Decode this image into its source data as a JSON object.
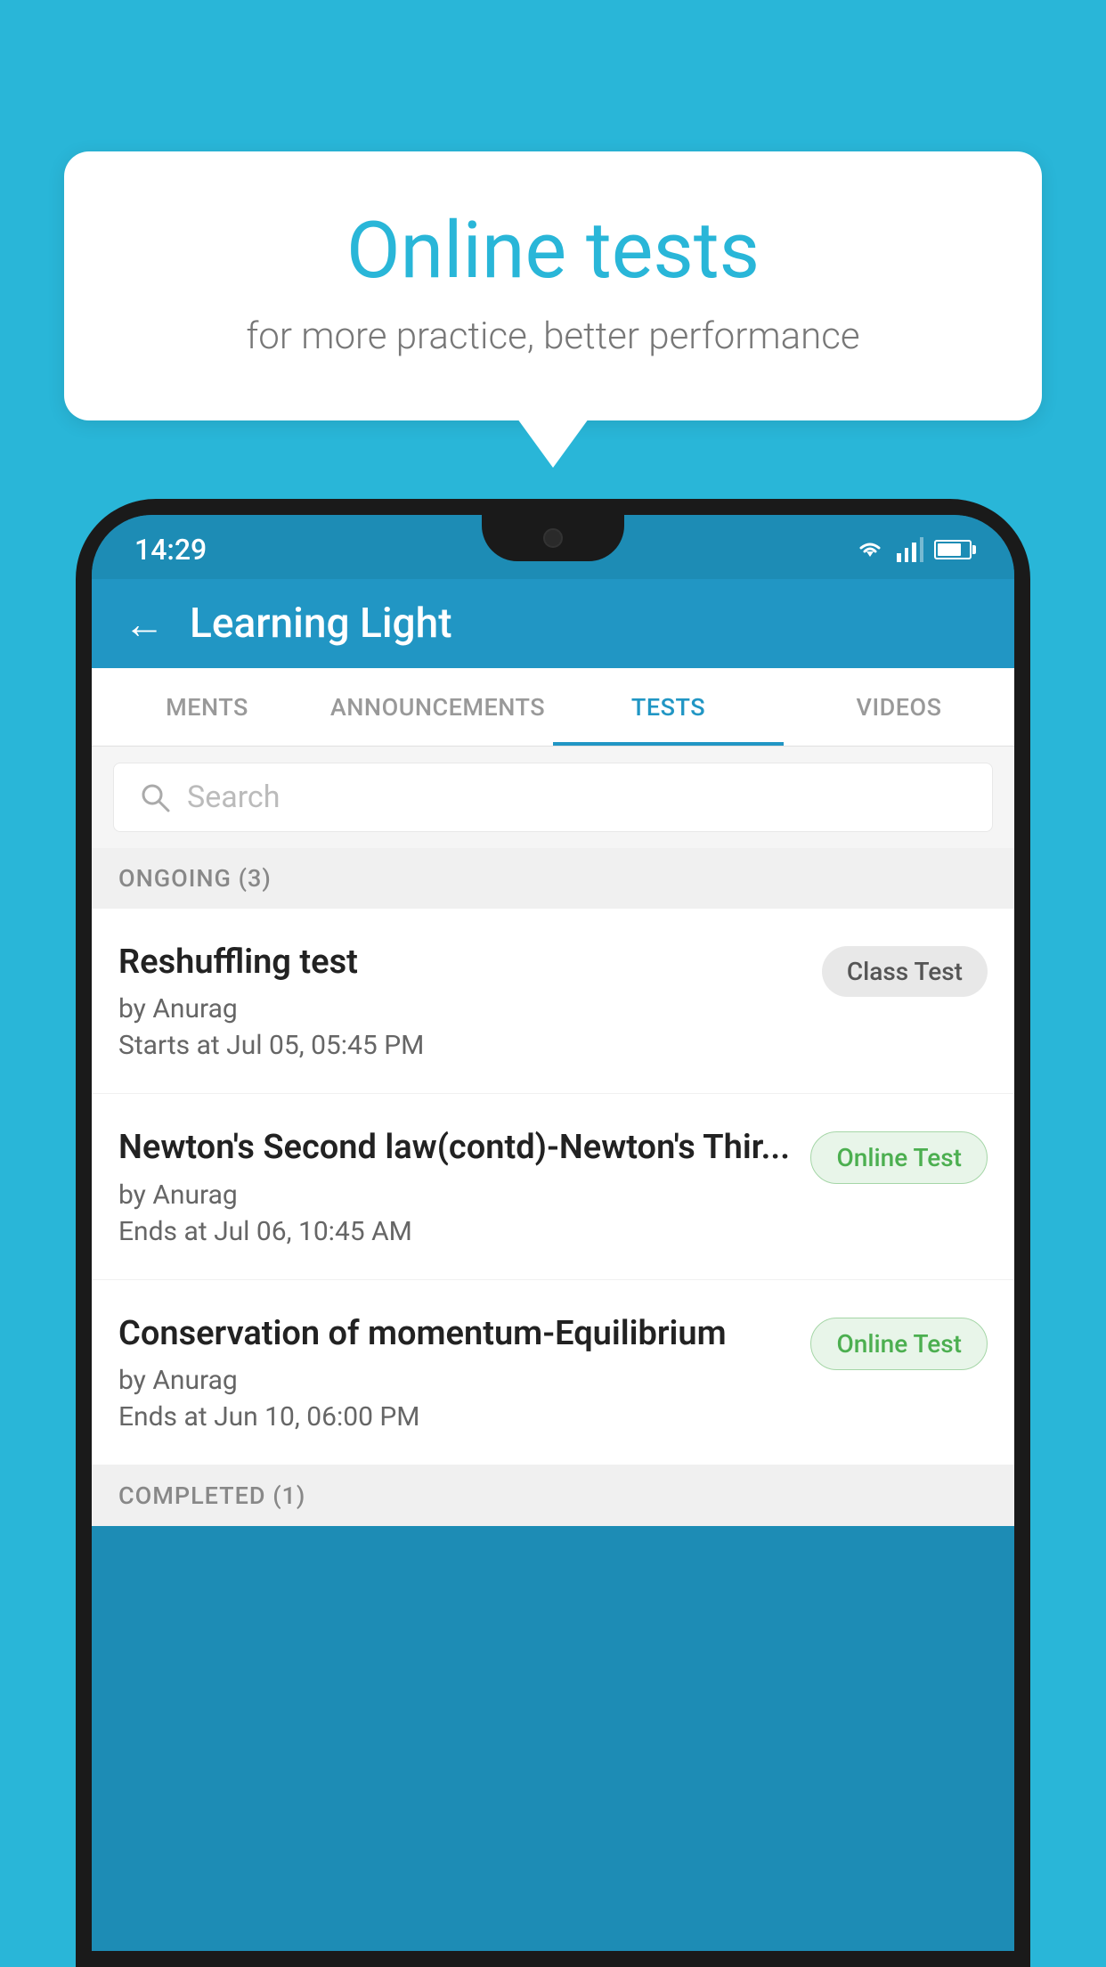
{
  "background": {
    "color": "#29b6d8"
  },
  "speech_bubble": {
    "title": "Online tests",
    "subtitle": "for more practice, better performance"
  },
  "phone": {
    "status_bar": {
      "time": "14:29"
    },
    "app_header": {
      "title": "Learning Light",
      "back_label": "←"
    },
    "tabs": [
      {
        "label": "MENTS",
        "active": false
      },
      {
        "label": "ANNOUNCEMENTS",
        "active": false
      },
      {
        "label": "TESTS",
        "active": true
      },
      {
        "label": "VIDEOS",
        "active": false
      }
    ],
    "search": {
      "placeholder": "Search"
    },
    "ongoing_section": {
      "label": "ONGOING (3)"
    },
    "tests": [
      {
        "name": "Reshuffling test",
        "author": "by Anurag",
        "time_label": "Starts at",
        "time": "Jul 05, 05:45 PM",
        "badge": "Class Test",
        "badge_type": "class"
      },
      {
        "name": "Newton's Second law(contd)-Newton's Thir...",
        "author": "by Anurag",
        "time_label": "Ends at",
        "time": "Jul 06, 10:45 AM",
        "badge": "Online Test",
        "badge_type": "online"
      },
      {
        "name": "Conservation of momentum-Equilibrium",
        "author": "by Anurag",
        "time_label": "Ends at",
        "time": "Jun 10, 06:00 PM",
        "badge": "Online Test",
        "badge_type": "online"
      }
    ],
    "completed_section": {
      "label": "COMPLETED (1)"
    }
  }
}
